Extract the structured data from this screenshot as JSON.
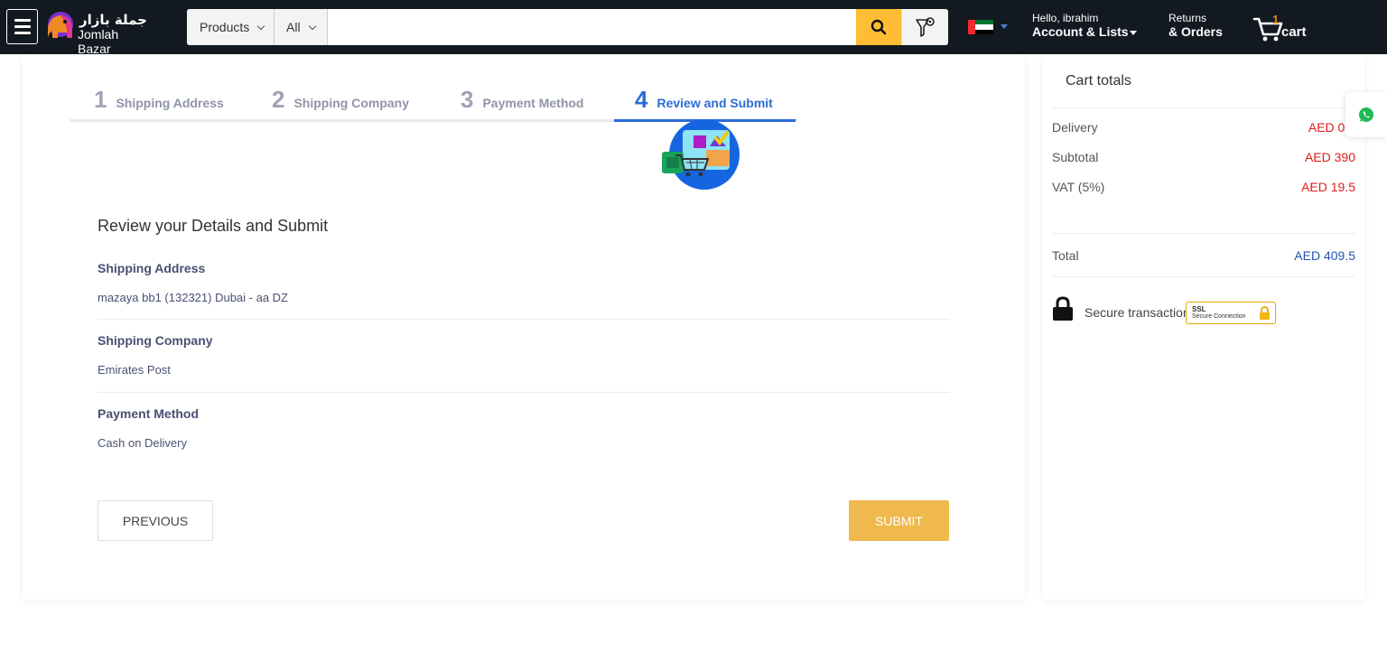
{
  "header": {
    "logo_arabic": "جملة بازار",
    "logo_latin": "Jomlah Bazar",
    "search": {
      "category_label": "Products",
      "scope_label": "All",
      "placeholder": "",
      "value": ""
    },
    "account": {
      "greeting": "Hello, ibrahim",
      "label": "Account & Lists"
    },
    "returns": {
      "line1": "Returns",
      "line2": "& Orders"
    },
    "cart": {
      "count": "1",
      "label": "cart"
    },
    "colors": {
      "header_bg": "#131921",
      "search_button": "#febd35",
      "cart_count": "#f08804"
    },
    "icons": {
      "menu": "hamburger-icon",
      "search": "search-icon",
      "filter": "filter-icon",
      "flag": "uae-flag-icon",
      "cart": "cart-icon"
    }
  },
  "checkout": {
    "steps": [
      {
        "number": "1",
        "label": "Shipping Address",
        "active": false
      },
      {
        "number": "2",
        "label": "Shipping Company",
        "active": false
      },
      {
        "number": "3",
        "label": "Payment Method",
        "active": false
      },
      {
        "number": "4",
        "label": "Review and Submit",
        "active": true
      }
    ],
    "review_title": "Review your Details and Submit",
    "sections": [
      {
        "heading": "Shipping Address",
        "value": "mazaya bb1 (132321) Dubai - aa DZ"
      },
      {
        "heading": "Shipping Company",
        "value": "Emirates Post"
      },
      {
        "heading": "Payment Method",
        "value": "Cash on Delivery"
      }
    ],
    "buttons": {
      "previous": "PREVIOUS",
      "submit": "SUBMIT"
    },
    "colors": {
      "active_step": "#2c6bd6",
      "submit_bg": "#efb94d"
    }
  },
  "cart_totals": {
    "title": "Cart totals",
    "rows": [
      {
        "label": "Delivery",
        "value": "AED 0.0"
      },
      {
        "label": "Subtotal",
        "value": "AED 390"
      },
      {
        "label": "VAT (5%)",
        "value": "AED 19.5"
      }
    ],
    "total": {
      "label": "Total",
      "value": "AED 409.5"
    },
    "secure_text": "Secure transaction",
    "ssl_badge": {
      "line1": "SSL",
      "line2": "Secure Connection"
    },
    "colors": {
      "value_red": "#e01b1b",
      "total_blue": "#2354b7"
    }
  },
  "floating": {
    "whatsapp_icon": "whatsapp-icon"
  }
}
